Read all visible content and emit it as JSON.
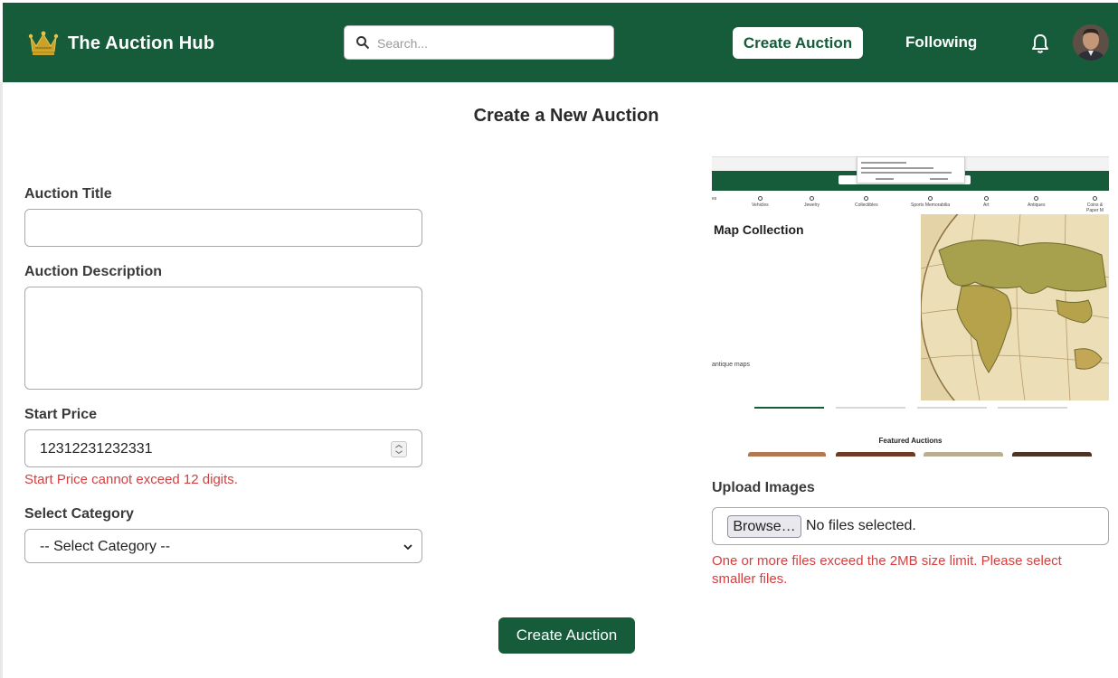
{
  "header": {
    "brand_title": "The Auction Hub",
    "search_placeholder": "Search...",
    "create_auction_label": "Create Auction",
    "following_label": "Following",
    "brand_color": "#165c3a",
    "icons": [
      "crown-icon",
      "search-icon",
      "bell-icon",
      "avatar"
    ]
  },
  "form": {
    "page_title": "Create a New Auction",
    "title_label": "Auction Title",
    "title_value": "",
    "description_label": "Auction Description",
    "description_value": "",
    "price_label": "Start Price",
    "price_value": "12312231232331",
    "price_error": "Start Price cannot exceed 12 digits.",
    "category_label": "Select Category",
    "category_selected": "-- Select Category --",
    "submit_label": "Create Auction",
    "error_color": "#d43f3f"
  },
  "preview": {
    "section_title": "Map Collection",
    "subtitle": "antique maps",
    "featured_label": "Featured Auctions",
    "categories": [
      "es",
      "Vehicles",
      "Jewelry",
      "Collectibles",
      "Sports Memorabilia",
      "Art",
      "Antiques",
      "Coins & Paper M"
    ]
  },
  "upload": {
    "label": "Upload Images",
    "browse_label": "Browse…",
    "file_status": "No files selected.",
    "error": "One or more files exceed the 2MB size limit. Please select smaller files."
  }
}
